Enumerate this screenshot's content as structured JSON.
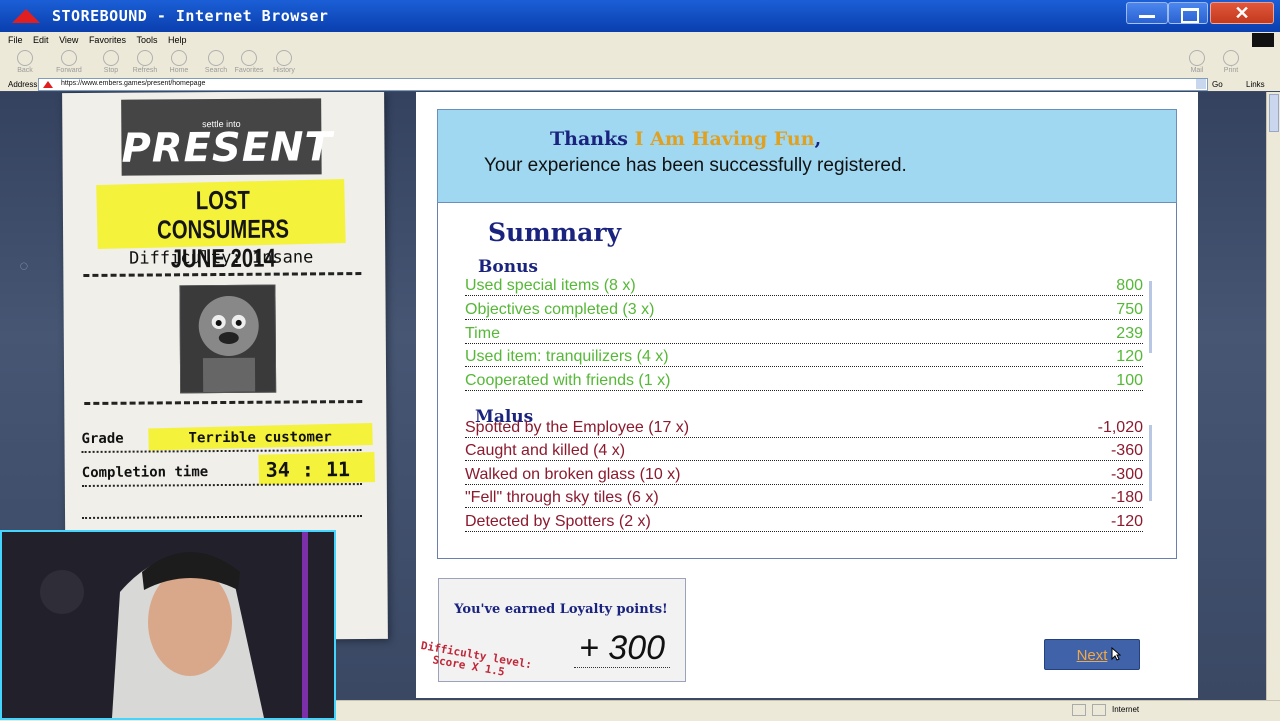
{
  "window": {
    "title": "STOREBOUND - Internet Browser",
    "close_glyph": "✕"
  },
  "menu": [
    "File",
    "Edit",
    "View",
    "Favorites",
    "Tools",
    "Help"
  ],
  "toolbar": {
    "back": "Back",
    "forward": "Forward",
    "stop": "Stop",
    "refresh": "Refresh",
    "home": "Home",
    "search": "Search",
    "favorites": "Favorites",
    "history": "History",
    "mail": "Mail",
    "print": "Print"
  },
  "address": {
    "label": "Address",
    "url": "https://www.embers.games/present/homepage",
    "go": "Go",
    "links": "Links"
  },
  "receipt": {
    "tagline": "settle into",
    "brand": "PRESENT",
    "level_line1": "LOST CONSUMERS",
    "level_line2": "JUNE 2014",
    "difficulty": "Difficulty: Insane",
    "grade_label": "Grade",
    "grade_value": "Terrible customer",
    "completion_label": "Completion time",
    "completion_value": "34 : 11"
  },
  "main": {
    "thanks_prefix": "Thanks",
    "player_name": "I Am Having Fun",
    "thanks_suffix": ",",
    "registered": "Your experience has been successfully registered.",
    "summary_title": "Summary",
    "bonus_title": "Bonus",
    "bonus": [
      {
        "label": "Used special items (8 x)",
        "value": "800"
      },
      {
        "label": "Objectives completed (3 x)",
        "value": "750"
      },
      {
        "label": "Time",
        "value": "239"
      },
      {
        "label": "Used item: tranquilizers (4 x)",
        "value": "120"
      },
      {
        "label": "Cooperated with friends (1 x)",
        "value": "100"
      }
    ],
    "malus_title": "Malus",
    "malus": [
      {
        "label": "Spotted by the Employee (17 x)",
        "value": "-1,020"
      },
      {
        "label": "Caught and killed (4 x)",
        "value": "-360"
      },
      {
        "label": "Walked on broken glass (10 x)",
        "value": "-300"
      },
      {
        "label": "\"Fell\" through sky tiles (6 x)",
        "value": "-180"
      },
      {
        "label": "Detected by Spotters (2 x)",
        "value": "-120"
      }
    ],
    "loyalty_title": "You've earned Loyalty points!",
    "loyalty_points": "+ 300",
    "difficulty_line1": "Difficulty level:",
    "difficulty_line2": "Score X 1.5",
    "next_label": "Next"
  },
  "status": {
    "zone": "Internet"
  },
  "colors": {
    "bonus": "#55b836",
    "malus": "#8b1a2e",
    "heading": "#1a237e",
    "banner": "#a0d8f2",
    "name": "#e0a020",
    "next_button": "#3f62a8"
  }
}
